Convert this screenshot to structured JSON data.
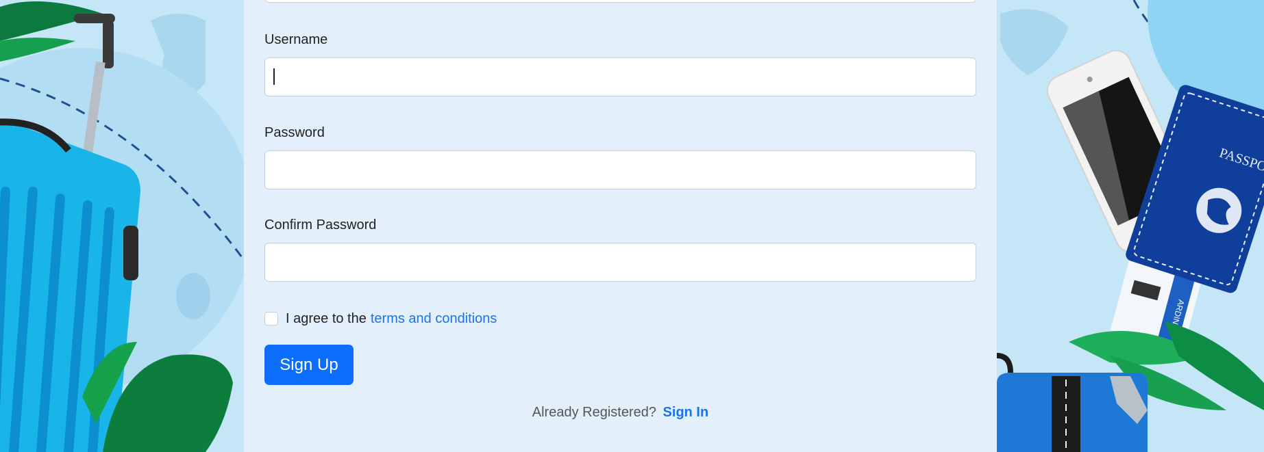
{
  "form": {
    "username_label": "Username",
    "username_value": "",
    "password_label": "Password",
    "password_value": "",
    "confirm_label": "Confirm Password",
    "confirm_value": "",
    "agree_prefix": "I agree to the",
    "agree_link": "terms and conditions",
    "signup_label": "Sign Up",
    "already_text": "Already Registered?",
    "signin_link": "Sign In"
  },
  "background": {
    "passport_text": "PASSPO",
    "boarding_text": "ARDING P"
  },
  "colors": {
    "accent": "#0d6efd",
    "link": "#1a73e8",
    "panel": "#e3effb",
    "background": "#c4e6f6"
  }
}
